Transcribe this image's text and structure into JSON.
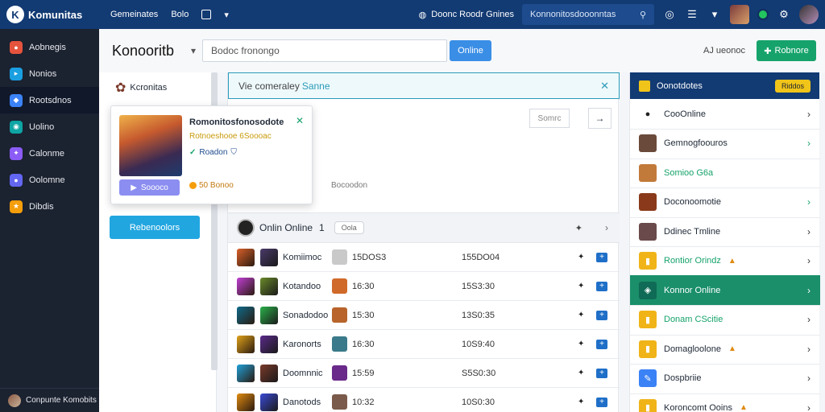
{
  "topbar": {
    "brand": "Komunitas",
    "nav": [
      "Gemeinates",
      "Bolo"
    ],
    "gamepad_label": "Doonc Roodr Gnines",
    "search_placeholder": "Konnonitosdooonntas"
  },
  "sidebar": {
    "items": [
      {
        "label": "Aobnegis",
        "color": "#e5533d",
        "icon": "game-icon"
      },
      {
        "label": "Nonios",
        "color": "#1a9fe0",
        "icon": "chat-icon"
      },
      {
        "label": "Rootsdnos",
        "color": "#3b82f6",
        "icon": "controller-icon",
        "active": true
      },
      {
        "label": "Uolino",
        "color": "#0ea5a4",
        "icon": "globe-icon"
      },
      {
        "label": "Calonme",
        "color": "#8b5cf6",
        "icon": "gear-icon"
      },
      {
        "label": "Oolomne",
        "color": "#6366f1",
        "icon": "user-icon"
      },
      {
        "label": "Dibdis",
        "color": "#f59e0b",
        "icon": "trophy-icon"
      }
    ],
    "footer": "Conpunte Komobits"
  },
  "header": {
    "title": "Konooritb",
    "filter_placeholder": "Bodoc fronongo",
    "filter_button": "Online",
    "link": "AJ ueonoc",
    "action_button": "Robnore"
  },
  "community": {
    "title": "Kcronitas",
    "button": "Rebenoolors"
  },
  "popup": {
    "name": "Romonitosfonosodote",
    "subtitle": "Rotnoeshooe 6Soooac",
    "status": "Roadon",
    "button": "Soooco",
    "coins": "50 Bonoo"
  },
  "center": {
    "banner_text": "Vie comeraley",
    "banner_highlight": "Sanne",
    "sort_label": "Somrc",
    "caption": "Bocoodon",
    "list_title": "Onlin Online",
    "list_count": "1",
    "list_pill": "Oola",
    "rows": [
      {
        "name": "Komiimoc",
        "value": "15DOS3",
        "value2": "155DO04",
        "c1": "#d9602a",
        "c2": "#4a3a6a",
        "c3": "#c9c9c9"
      },
      {
        "name": "Kotandoo",
        "value": "16:30",
        "value2": "15S3:30",
        "c1": "#c13fd6",
        "c2": "#6a8a2a",
        "c3": "#d06a2a"
      },
      {
        "name": "Sonadodoo",
        "value": "15:30",
        "value2": "13S0:35",
        "c1": "#0f6b8a",
        "c2": "#2bb04a",
        "c3": "#b8642a"
      },
      {
        "name": "Karonorts",
        "value": "16:30",
        "value2": "10S9:40",
        "c1": "#e0a21a",
        "c2": "#5a2a8a",
        "c3": "#3a7a8a"
      },
      {
        "name": "Doomnnic",
        "value": "15:59",
        "value2": "S5S0:30",
        "c1": "#1fa0d8",
        "c2": "#7a3a2a",
        "c3": "#6a2a8a"
      },
      {
        "name": "Danotods",
        "value": "10:32",
        "value2": "10S0:30",
        "c1": "#e08a10",
        "c2": "#3a4ad6",
        "c3": "#7a5a4a"
      }
    ]
  },
  "right": {
    "title": "Oonotdotes",
    "badge": "Riddos",
    "items": [
      {
        "label": "CooOnline",
        "color": "#ffffff",
        "icon": "user-icon"
      },
      {
        "label": "Gemnogfoouros",
        "color": "#6a4a3a",
        "icon": "avatar-icon",
        "chev_green": true
      },
      {
        "label": "Somioo G6a",
        "color": "#c27a3a",
        "icon": "avatar-icon",
        "green": true,
        "no_chev": true
      },
      {
        "label": "Doconoomotie",
        "color": "#8a3a1a",
        "icon": "avatar-icon",
        "chev_green": true
      },
      {
        "label": "Ddinec Tmline",
        "color": "#6a4a4a",
        "icon": "avatar-icon"
      },
      {
        "label": "Rontior Orindz",
        "color": "#f0b419",
        "icon": "badge-icon",
        "green": true,
        "flame": true
      },
      {
        "label": "Konnor Online",
        "color": "#0f6b55",
        "icon": "team-icon",
        "active": true
      },
      {
        "label": "Donam CScitie",
        "color": "#f0b419",
        "icon": "badge-icon",
        "green": true
      },
      {
        "label": "Domagloolone",
        "color": "#f0b419",
        "icon": "badge-icon",
        "flame": true
      },
      {
        "label": "Dospbriie",
        "color": "#3b82f6",
        "icon": "note-icon"
      },
      {
        "label": "Koroncomt Ooins",
        "color": "#f0b419",
        "icon": "badge-icon",
        "flame": true
      }
    ]
  }
}
